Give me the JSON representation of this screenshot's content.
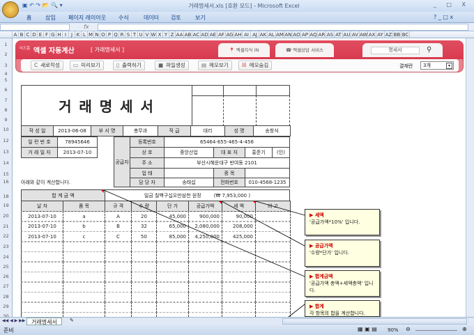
{
  "window": {
    "title": "거래명세서.xls  [호환 모드] - Microsoft Excel",
    "controls": [
      "_",
      "□",
      "X"
    ]
  },
  "ribbon": {
    "tabs": [
      "홈",
      "삽입",
      "페이지 레이아웃",
      "수식",
      "데이터",
      "검토",
      "보기"
    ]
  },
  "formula_bar": {
    "name_box": "",
    "fx": "fx",
    "value": ""
  },
  "columns": [
    "A",
    "B",
    "C",
    "D",
    "E",
    "F",
    "G",
    "H",
    "I",
    "J",
    "K",
    "L",
    "M",
    "N",
    "O",
    "P",
    "Q",
    "R",
    "S",
    "T",
    "U",
    "V",
    "W",
    "X",
    "Y",
    "Z",
    "AA",
    "AB",
    "AC",
    "AD",
    "AE",
    "AF",
    "AG",
    "AH",
    "AI",
    "AJ",
    "AK",
    "AL",
    "AM",
    "AN",
    "AO",
    "AP",
    "AQ",
    "AR",
    "AS",
    "AT",
    "AU",
    "AV",
    "AW",
    "AX",
    "AY",
    "AZ",
    "BB",
    "BC"
  ],
  "rows": [
    "1",
    "2",
    "3",
    "4",
    "5",
    "6",
    "7",
    "8",
    "9",
    "10",
    "12",
    "13",
    "14",
    "15",
    "16",
    "18",
    "19",
    "20",
    "21",
    "22",
    "23",
    "24",
    "25",
    "26",
    "27",
    "28",
    "29",
    "30"
  ],
  "banner": {
    "brand": "비즈폼",
    "app_title": "엑셀 자동계산",
    "doc_title": "[ 거래명세서 ]",
    "link1": "엑셀지식 IN",
    "link2": "엑셀상담 서비스",
    "search_value": "명세서",
    "buttons": [
      "새로작성",
      "미리보기",
      "출력하기",
      "파일생성",
      "메모보기",
      "메모숨김"
    ],
    "icons": [
      "refresh-icon",
      "preview-icon",
      "print-icon",
      "file-icon",
      "memo-show-icon",
      "memo-hide-icon"
    ],
    "result_label": "결재란",
    "result_value": "3개"
  },
  "form": {
    "title": "거 래 명 세 서",
    "header_row": {
      "labels": [
        "작 성 일",
        "부 서 명",
        "직 급",
        "성 명"
      ],
      "values": [
        "2013-06-08",
        "총무과",
        "대리",
        "송창식"
      ]
    },
    "serial_label": "일 련 번 호",
    "serial": "78945646",
    "date_label": "거 래 일 자",
    "date": "2013-07-10",
    "supplier": {
      "label": "공급자",
      "reg_label": "등록번호",
      "reg": "65464-655-465-4-456",
      "name_label": "상 호",
      "name": "중앙산업",
      "rep_label": "대 표 자",
      "rep": "홍준기",
      "seal": "(인)",
      "addr_label": "주 소",
      "addr": "부산시해운대구 반여동 2101",
      "biz_label": "업 태",
      "biz": "",
      "item_label": "종 목",
      "item": "",
      "mgr_label": "담 당 자",
      "mgr": "송태섭",
      "tel_label": "전화번호",
      "tel": "010-4568-1235"
    },
    "note": "아래와 같이 계산합니다.",
    "total_label": "합 계 금 액",
    "total_text": "일금  칠백구십오만삼천  원정",
    "total_num": "(₩  7,953,000 )",
    "headers": [
      "날 자",
      "품 목",
      "규 격",
      "수 량",
      "단 가",
      "공급가액",
      "세 액",
      "비 고"
    ],
    "items": [
      [
        "2013-07-10",
        "a",
        "A",
        "20",
        "45,000",
        "900,000",
        "90,000",
        ""
      ],
      [
        "2013-07-10",
        "b",
        "B",
        "32",
        "65,000",
        "2,080,000",
        "208,000",
        ""
      ],
      [
        "2013-07-10",
        "c",
        "C",
        "50",
        "85,000",
        "4,250,000",
        "425,000",
        ""
      ]
    ]
  },
  "comments": [
    {
      "title": "세액",
      "body": "'공급가액*10%' 입니다."
    },
    {
      "title": "공급가액",
      "body": "'수량*단가' 입니다."
    },
    {
      "title": "합계금액",
      "body": "'공급가액 총액+세액총액' 입니다."
    },
    {
      "title": "합계",
      "body": "각 항목의 합을 계산합니다."
    }
  ],
  "sheet_tab": "거래명세서",
  "status": {
    "ready": "준비",
    "zoom": "90%"
  }
}
